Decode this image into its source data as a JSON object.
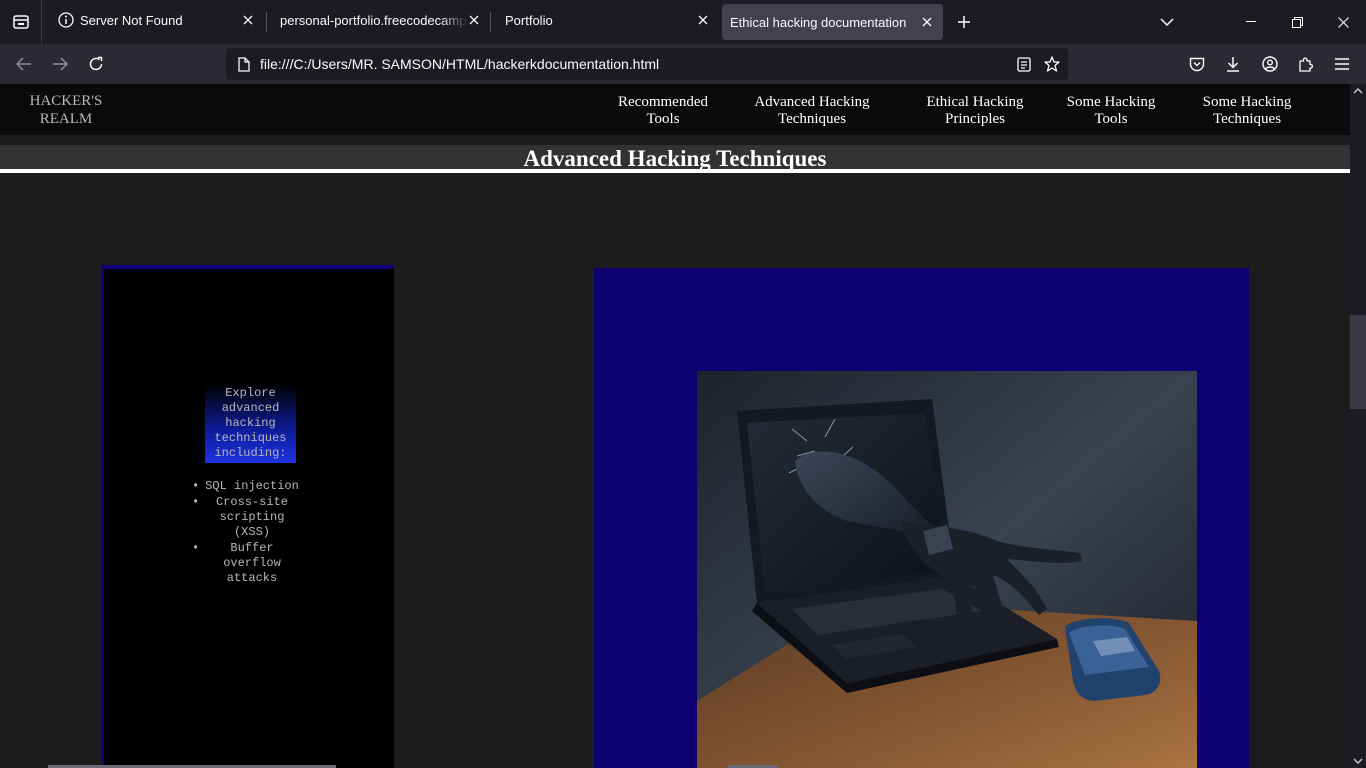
{
  "browser": {
    "tabs": [
      {
        "title": "Server Not Found",
        "active": false
      },
      {
        "title": "personal-portfolio.freecodecamp.ro",
        "active": false
      },
      {
        "title": "Portfolio",
        "active": false
      },
      {
        "title": "Ethical hacking documentation",
        "active": true
      }
    ],
    "url": "file:///C:/Users/MR. SAMSON/HTML/hackerkdocumentation.html"
  },
  "site": {
    "logo_line1": "HACKER'S",
    "logo_line2": "REALM",
    "nav": [
      {
        "line1": "Recommended",
        "line2": "Tools"
      },
      {
        "line1": "Advanced Hacking",
        "line2": "Techniques"
      },
      {
        "line1": "Ethical Hacking",
        "line2": "Principles"
      },
      {
        "line1": "Some Hacking",
        "line2": "Tools"
      },
      {
        "line1": "Some Hacking",
        "line2": "Techniques"
      }
    ],
    "section_title": "Advanced Hacking Techniques",
    "intro_lines": [
      "Explore",
      "advanced",
      "hacking",
      "techniques",
      "including:"
    ],
    "techniques": [
      {
        "lines": [
          "SQL injection"
        ]
      },
      {
        "lines": [
          "Cross-site",
          "scripting",
          "(XSS)"
        ]
      },
      {
        "lines": [
          "Buffer",
          "overflow",
          "attacks"
        ]
      }
    ]
  },
  "colors": {
    "panel_blue": "#0e0070",
    "card_border": "#15007a",
    "gradient_blue": "#1c33e0"
  }
}
